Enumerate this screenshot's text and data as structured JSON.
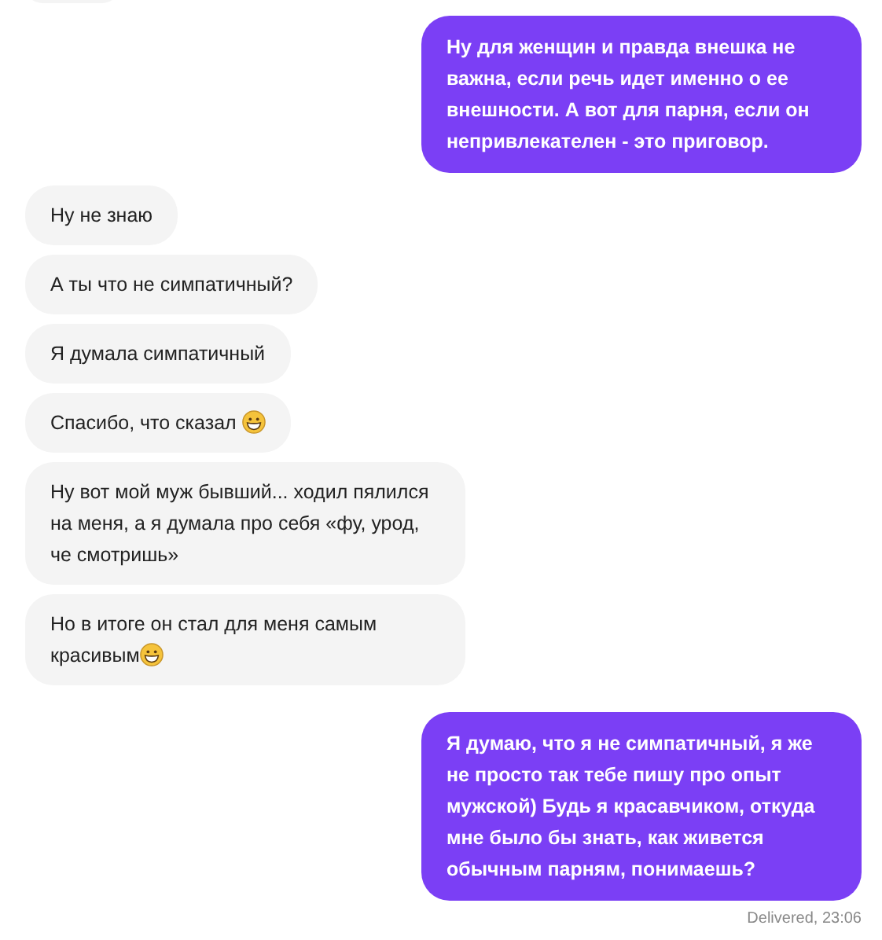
{
  "messages": [
    {
      "kind": "partial"
    },
    {
      "kind": "sent",
      "text": "Ну для женщин и правда внешка не важна, если речь идет именно о ее внешности. А вот для парня, если он непривлекателен - это приговор.",
      "emoji": false
    },
    {
      "kind": "received",
      "text": "Ну не знаю",
      "emoji": false
    },
    {
      "kind": "received",
      "text": "А ты что не симпатичный?",
      "emoji": false
    },
    {
      "kind": "received",
      "text": "Я думала симпатичный",
      "emoji": false
    },
    {
      "kind": "received",
      "text": "Спасибо, что сказал ",
      "emoji": true
    },
    {
      "kind": "received",
      "text": "Ну вот мой муж бывший... ходил пялился на меня, а я думала про себя «фу, урод, че смотришь»",
      "emoji": false
    },
    {
      "kind": "received",
      "text": "Но в итоге он стал для меня самым красивым",
      "emoji": true
    },
    {
      "kind": "sent",
      "text": "Я думаю, что я не симпатичный, я же не просто так тебе пишу про опыт мужской) Будь я красавчиком, откуда мне было бы знать, как живется обычным парням, понимаешь?",
      "emoji": false
    }
  ],
  "status": "Delivered, 23:06"
}
